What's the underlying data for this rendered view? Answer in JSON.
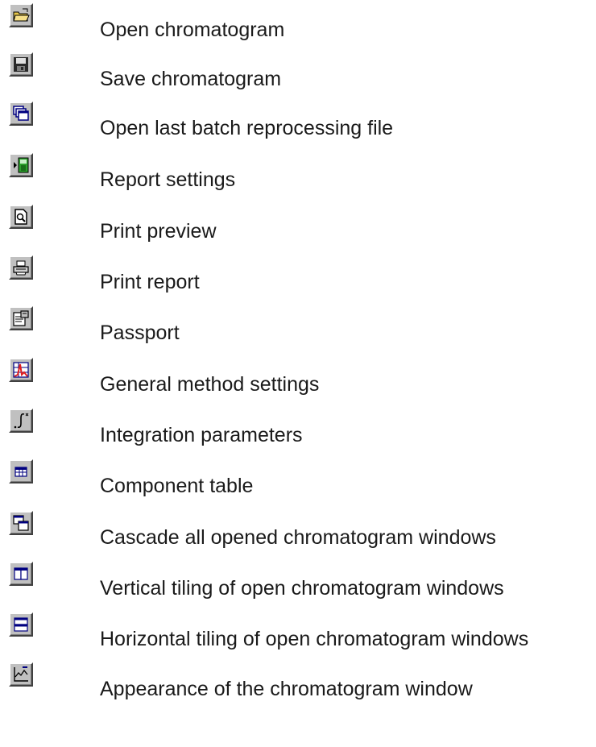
{
  "toolbar_legend": [
    {
      "icon": "open-folder-icon",
      "label": "Open chromatogram"
    },
    {
      "icon": "floppy-disk-icon",
      "label": "Save chromatogram"
    },
    {
      "icon": "batch-files-icon",
      "label": "Open last batch reprocessing file"
    },
    {
      "icon": "report-settings-icon",
      "label": "Report settings"
    },
    {
      "icon": "print-preview-icon",
      "label": "Print preview"
    },
    {
      "icon": "printer-icon",
      "label": "Print report"
    },
    {
      "icon": "passport-icon",
      "label": "Passport"
    },
    {
      "icon": "method-settings-icon",
      "label": "General method settings"
    },
    {
      "icon": "integral-icon",
      "label": "Integration parameters"
    },
    {
      "icon": "table-icon",
      "label": "Component table"
    },
    {
      "icon": "cascade-windows-icon",
      "label": "Cascade all opened chromatogram windows"
    },
    {
      "icon": "tile-vertical-icon",
      "label": "Vertical tiling of open chromatogram windows"
    },
    {
      "icon": "tile-horizontal-icon",
      "label": "Horizontal tiling of open chromatogram windows"
    },
    {
      "icon": "chart-appearance-icon",
      "label": "Appearance of the chromatogram window"
    }
  ]
}
